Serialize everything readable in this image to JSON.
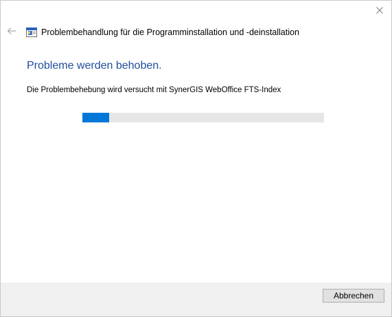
{
  "window": {
    "title": "Problembehandlung für die Programminstallation und -deinstallation",
    "app_icon": "troubleshooter-icon",
    "back_icon": "back-arrow-icon",
    "close_icon": "close-icon"
  },
  "main": {
    "heading": "Probleme werden behoben.",
    "status_text": "Die Problembehebung wird versucht mit SynerGIS WebOffice FTS-Index",
    "progress_fraction": 0.11
  },
  "footer": {
    "cancel_label": "Abbrechen"
  },
  "colors": {
    "heading": "#1f4e9b",
    "progress_fill": "#0078d7",
    "progress_track": "#e6e6e6",
    "footer_bg": "#f0f0f0"
  }
}
